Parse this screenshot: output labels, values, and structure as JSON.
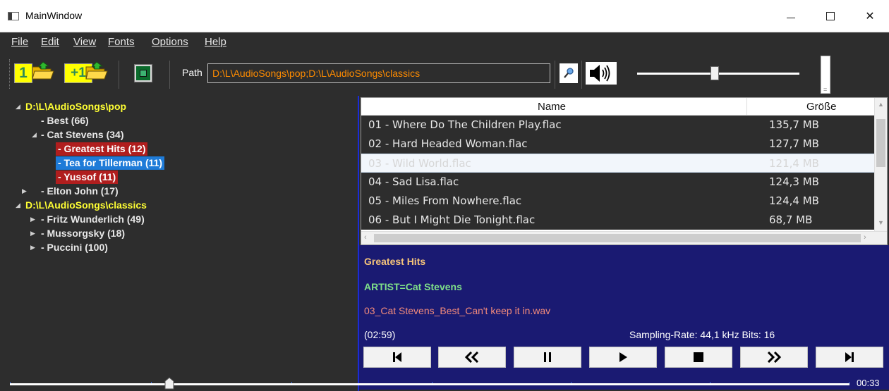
{
  "window": {
    "title": "MainWindow"
  },
  "menu": [
    "File",
    "Edit",
    "View",
    "Fonts",
    "Options",
    "Help"
  ],
  "toolbar": {
    "btn1_label": "1",
    "btn2_label": "+1",
    "path_label": "Path",
    "path_value": "D:\\L\\AudioSongs\\pop;D:\\L\\AudioSongs\\classics",
    "volume_level_percent": 48
  },
  "tree": [
    {
      "label": "D:\\L\\AudioSongs\\pop",
      "kind": "root",
      "expanded": true
    },
    {
      "label": "- Best (66)",
      "kind": "item"
    },
    {
      "label": "- Cat Stevens (34)",
      "kind": "item",
      "expanded": true
    },
    {
      "label": "- Greatest Hits (12)",
      "kind": "red"
    },
    {
      "label": "- Tea for Tillerman (11)",
      "kind": "blue"
    },
    {
      "label": "- Yussof (11)",
      "kind": "red"
    },
    {
      "label": "- Elton John (17)",
      "kind": "item",
      "collapsed": true
    },
    {
      "label": "D:\\L\\AudioSongs\\classics",
      "kind": "root",
      "expanded": true
    },
    {
      "label": "- Fritz Wunderlich (49)",
      "kind": "item",
      "collapsed": true
    },
    {
      "label": "- Mussorgsky (18)",
      "kind": "item",
      "collapsed": true
    },
    {
      "label": "- Puccini (100)",
      "kind": "item",
      "collapsed": true
    }
  ],
  "table": {
    "columns": [
      "Name",
      "Größe"
    ],
    "rows": [
      {
        "name": "01 - Where Do The Children Play.flac",
        "size": "135,7 MB"
      },
      {
        "name": "02 - Hard Headed Woman.flac",
        "size": "127,7 MB"
      },
      {
        "name": "03 - Wild World.flac",
        "size": "121,4 MB",
        "selected": true
      },
      {
        "name": "04 - Sad Lisa.flac",
        "size": "124,3 MB"
      },
      {
        "name": "05 - Miles From Nowhere.flac",
        "size": "124,4 MB"
      },
      {
        "name": "06 - But I Might Die Tonight.flac",
        "size": "68,7 MB"
      }
    ]
  },
  "info": {
    "album": "Greatest Hits",
    "artist": "ARTIST=Cat Stevens",
    "file": "03_Cat Stevens_Best_Can't keep it in.wav",
    "duration": "(02:59)",
    "format": "Sampling-Rate: 44,1 kHz  Bits: 16"
  },
  "controls": [
    "skip-to-start-icon",
    "rewind-icon",
    "pause-icon",
    "play-icon",
    "stop-icon",
    "fast-forward-icon",
    "skip-to-end-icon"
  ],
  "seek": {
    "position_fraction": 0.19,
    "time": "00:33"
  },
  "colors": {
    "background": "#2d2d2d",
    "root_yellow": "#ffff33",
    "path_orange": "#ff8c00",
    "info_bg": "#1a1a72",
    "selected_red": "#b01e1e",
    "selected_blue": "#1e7bd8"
  }
}
